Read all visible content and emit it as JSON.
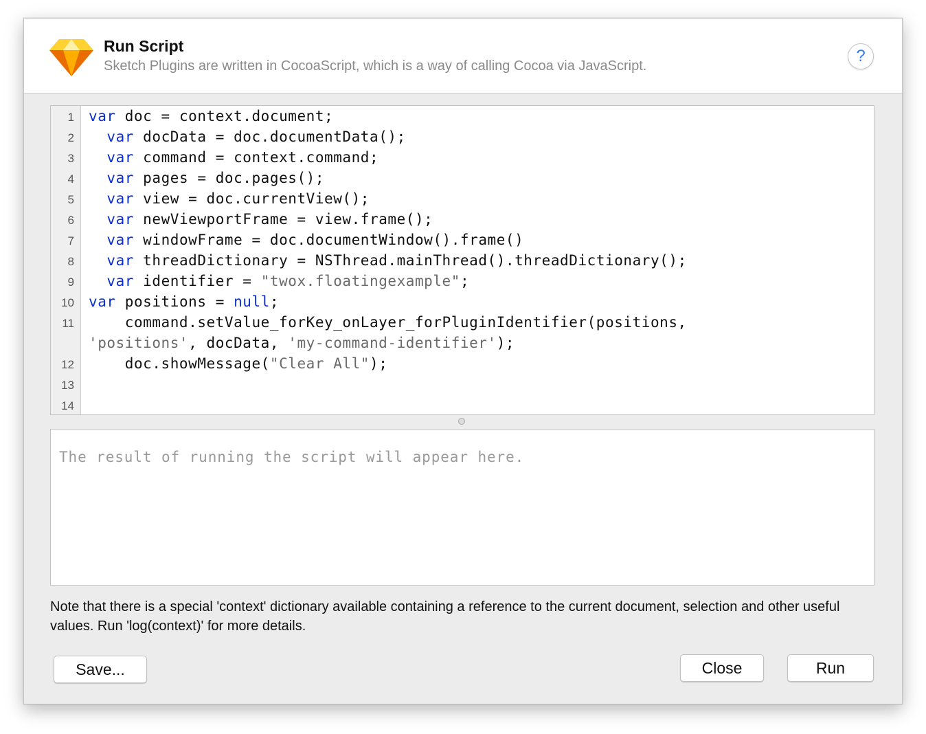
{
  "header": {
    "title": "Run Script",
    "subtitle": "Sketch Plugins are written in CocoaScript, which is a way of calling Cocoa via JavaScript.",
    "help_label": "?"
  },
  "editor": {
    "line_numbers": [
      "1",
      "2",
      "3",
      "4",
      "5",
      "6",
      "7",
      "8",
      "9",
      "10",
      "11",
      "12",
      "13",
      "14"
    ],
    "lines": [
      [
        {
          "t": "var",
          "c": "kw"
        },
        {
          "t": " doc = context.document;",
          "c": ""
        }
      ],
      [
        {
          "t": "  ",
          "c": ""
        },
        {
          "t": "var",
          "c": "kw"
        },
        {
          "t": " docData = doc.documentData();",
          "c": ""
        }
      ],
      [
        {
          "t": "  ",
          "c": ""
        },
        {
          "t": "var",
          "c": "kw"
        },
        {
          "t": " command = context.command;",
          "c": ""
        }
      ],
      [
        {
          "t": "  ",
          "c": ""
        },
        {
          "t": "var",
          "c": "kw"
        },
        {
          "t": " pages = doc.pages();",
          "c": ""
        }
      ],
      [
        {
          "t": "  ",
          "c": ""
        },
        {
          "t": "var",
          "c": "kw"
        },
        {
          "t": " view = doc.currentView();",
          "c": ""
        }
      ],
      [
        {
          "t": "  ",
          "c": ""
        },
        {
          "t": "var",
          "c": "kw"
        },
        {
          "t": " newViewportFrame = view.frame();",
          "c": ""
        }
      ],
      [
        {
          "t": "  ",
          "c": ""
        },
        {
          "t": "var",
          "c": "kw"
        },
        {
          "t": " windowFrame = doc.documentWindow().frame()",
          "c": ""
        }
      ],
      [
        {
          "t": "  ",
          "c": ""
        },
        {
          "t": "var",
          "c": "kw"
        },
        {
          "t": " threadDictionary = NSThread.mainThread().threadDictionary();",
          "c": ""
        }
      ],
      [
        {
          "t": "  ",
          "c": ""
        },
        {
          "t": "var",
          "c": "kw"
        },
        {
          "t": " identifier = ",
          "c": ""
        },
        {
          "t": "\"twox.floatingexample\"",
          "c": "str"
        },
        {
          "t": ";",
          "c": ""
        }
      ],
      [
        {
          "t": "var",
          "c": "kw"
        },
        {
          "t": " positions = ",
          "c": ""
        },
        {
          "t": "null",
          "c": "kw"
        },
        {
          "t": ";",
          "c": ""
        }
      ],
      [
        {
          "t": "    command.setValue_forKey_onLayer_forPluginIdentifier(positions,",
          "c": ""
        }
      ],
      [
        {
          "t": "'positions'",
          "c": "str"
        },
        {
          "t": ", docData, ",
          "c": ""
        },
        {
          "t": "'my-command-identifier'",
          "c": "str"
        },
        {
          "t": ");",
          "c": ""
        }
      ],
      [
        {
          "t": "    doc.showMessage(",
          "c": ""
        },
        {
          "t": "\"Clear All\"",
          "c": "str"
        },
        {
          "t": ");",
          "c": ""
        }
      ],
      [],
      []
    ]
  },
  "output": {
    "placeholder": "The result of running the script will appear here."
  },
  "note": "Note that there is a special 'context' dictionary available containing a reference to the current document, selection and other useful values. Run 'log(context)' for more details.",
  "buttons": {
    "save_label": "Save...",
    "close_label": "Close",
    "run_label": "Run"
  },
  "icons": {
    "logo": "sketch-diamond-icon",
    "help": "question-mark-icon"
  },
  "colors": {
    "keyword": "#0c2fd3",
    "string": "#6a6a6a",
    "help_accent": "#2f7cf6",
    "logo_orange": "#f7a623",
    "logo_yellow": "#fdd231"
  }
}
